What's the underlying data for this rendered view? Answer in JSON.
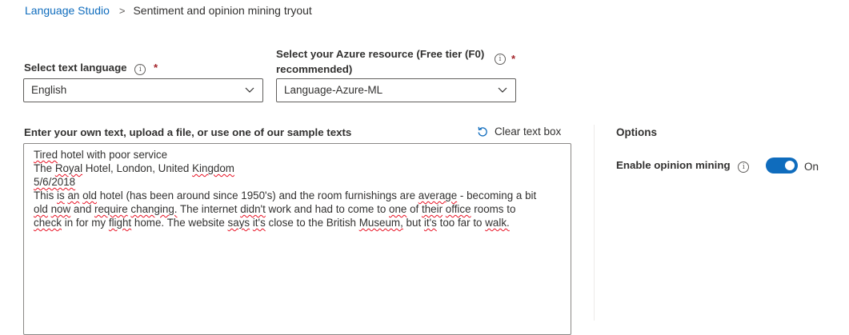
{
  "breadcrumb": {
    "root": "Language Studio",
    "separator": ">",
    "current": "Sentiment and opinion mining tryout"
  },
  "language": {
    "label": "Select text language",
    "required_mark": "*",
    "value": "English"
  },
  "resource": {
    "label_line1": "Select your Azure resource (Free tier (F0)",
    "label_line2": "recommended)",
    "required_mark": "*",
    "value": "Language-Azure-ML"
  },
  "input": {
    "label": "Enter your own text, upload a file, or use one of our sample texts",
    "clear_label": "Clear text box",
    "text_lines": [
      "Tired hotel with poor service",
      "The Royal Hotel, London, United Kingdom",
      "5/6/2018",
      "This is an old hotel (has been around since 1950's) and the room furnishings are average - becoming a bit",
      "old now and require changing. The internet didn't work and had to come to one of their office rooms to",
      "check in for my flight home. The website says it's close to the British Museum, but it's too far to walk."
    ]
  },
  "options": {
    "title": "Options",
    "opinion_mining_label": "Enable opinion mining",
    "toggle_state": "On",
    "toggle_on": true
  },
  "colors": {
    "link": "#0f6cbd",
    "toggle_on": "#0f6cbd",
    "required": "#a4262c",
    "spellcheck": "#e81123"
  }
}
